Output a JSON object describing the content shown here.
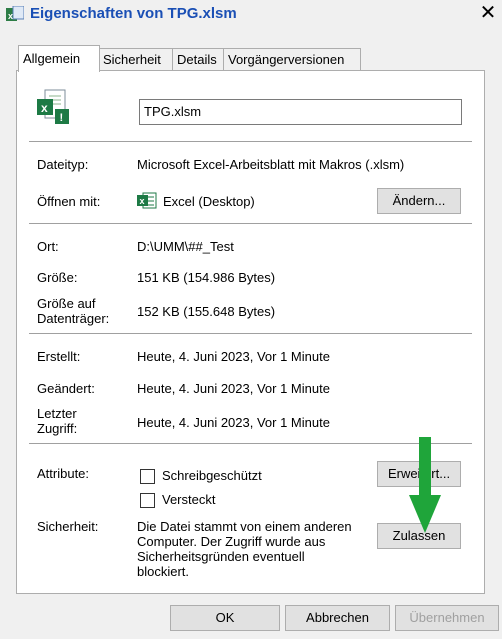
{
  "window": {
    "title": "Eigenschaften von TPG.xlsm",
    "close_glyph": "✕"
  },
  "tabs": [
    "Allgemein",
    "Sicherheit",
    "Details",
    "Vorgängerversionen"
  ],
  "general": {
    "filename": "TPG.xlsm",
    "dateityp_label": "Dateityp:",
    "dateityp_value": "Microsoft Excel-Arbeitsblatt mit Makros (.xlsm)",
    "oeffnen_label": "Öffnen mit:",
    "oeffnen_value": "Excel (Desktop)",
    "aendern_button": "Ändern...",
    "ort_label": "Ort:",
    "ort_value": "D:\\UMM\\##_Test",
    "groesse_label": "Größe:",
    "groesse_value": "151 KB (154.986 Bytes)",
    "groesse_datentraeger_label_1": "Größe auf",
    "groesse_datentraeger_label_2": "Datenträger:",
    "groesse_datentraeger_value": "152 KB (155.648 Bytes)",
    "erstellt_label": "Erstellt:",
    "erstellt_value": "Heute, 4. Juni 2023, Vor 1 Minute",
    "geaendert_label": "Geändert:",
    "geaendert_value": "Heute, 4. Juni 2023, Vor 1 Minute",
    "zugriff_label_1": "Letzter",
    "zugriff_label_2": "Zugriff:",
    "zugriff_value": "Heute, 4. Juni 2023, Vor 1 Minute",
    "attribute_label": "Attribute:",
    "schreibgeschuetzt": "Schreibgeschützt",
    "versteckt": "Versteckt",
    "erweitert_button": "Erweitert...",
    "sicherheit_label": "Sicherheit:",
    "sicherheit_text_1": "Die Datei stammt von einem anderen",
    "sicherheit_text_2": "Computer. Der Zugriff wurde aus",
    "sicherheit_text_3": "Sicherheitsgründen eventuell",
    "sicherheit_text_4": "blockiert.",
    "zulassen_button": "Zulassen"
  },
  "footer": {
    "ok": "OK",
    "abbrechen": "Abbrechen",
    "uebernehmen": "Übernehmen"
  },
  "colors": {
    "arrow": "#1fa53a",
    "excel_green": "#1d7a45",
    "title_blue": "#1a4fb5"
  }
}
